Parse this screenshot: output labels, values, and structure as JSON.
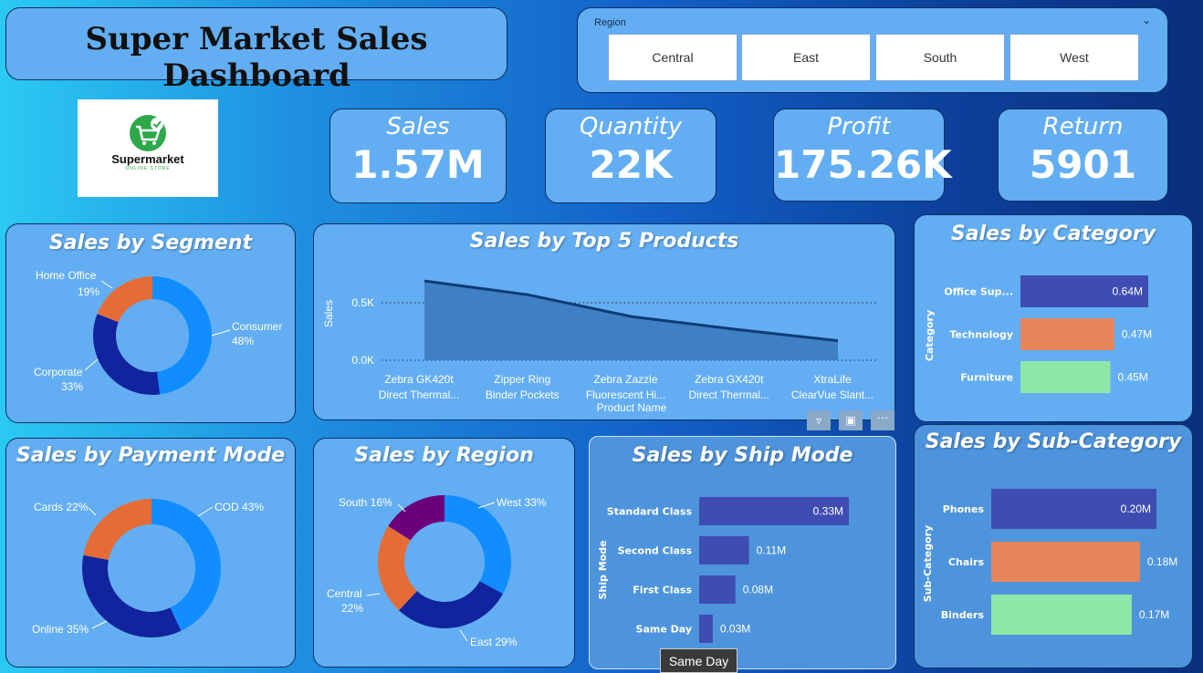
{
  "dashboard": {
    "title": "Super Market Sales Dashboard"
  },
  "slicer": {
    "label": "Region",
    "options": [
      "Central",
      "East",
      "South",
      "West"
    ]
  },
  "logo": {
    "name": "Supermarket",
    "tagline": "ONLINE STORE"
  },
  "kpis": [
    {
      "label": "Sales",
      "value": "1.57M"
    },
    {
      "label": "Quantity",
      "value": "22K"
    },
    {
      "label": "Profit",
      "value": "175.26K"
    },
    {
      "label": "Return",
      "value": "5901"
    }
  ],
  "tooltip": {
    "text": "Same Day"
  },
  "colors": {
    "blue": "#118dff",
    "navy": "#12239e",
    "orange": "#e66c37",
    "purple": "#6b007b",
    "barBlue": "#3f4db3",
    "barOrange": "#e8845a",
    "barGreen": "#8de8a8"
  },
  "chart_data": [
    {
      "id": "segment",
      "type": "pie",
      "title": "Sales by Segment",
      "categories": [
        "Consumer",
        "Corporate",
        "Home Office"
      ],
      "values": [
        48,
        33,
        19
      ],
      "labels": [
        [
          "Consumer",
          "48%"
        ],
        [
          "Corporate",
          "33%"
        ],
        [
          "Home Office",
          "19%"
        ]
      ]
    },
    {
      "id": "top5",
      "type": "area",
      "title": "Sales by Top 5 Products",
      "xlabel": "Product Name",
      "ylabel": "Sales",
      "categories": [
        [
          "Zebra GK420t",
          "Direct Thermal..."
        ],
        [
          "Zipper Ring",
          "Binder Pockets"
        ],
        [
          "Zebra Zazzle",
          "Fluorescent Hi..."
        ],
        [
          "Zebra GX420t",
          "Direct Thermal..."
        ],
        [
          "XtraLife",
          "ClearVue Slant..."
        ]
      ],
      "values": [
        0.69,
        0.57,
        0.38,
        0.27,
        0.17
      ],
      "yticks": [
        "0.0K",
        "0.5K"
      ],
      "ylim": [
        0,
        0.75
      ]
    },
    {
      "id": "category",
      "type": "bar",
      "title": "Sales by Category",
      "ylabel": "Category",
      "categories": [
        "Office Sup...",
        "Technology",
        "Furniture"
      ],
      "values": [
        0.64,
        0.47,
        0.45
      ],
      "value_labels": [
        "0.64M",
        "0.47M",
        "0.45M"
      ]
    },
    {
      "id": "payment",
      "type": "pie",
      "title": "Sales by Payment Mode",
      "categories": [
        "COD",
        "Online",
        "Cards"
      ],
      "values": [
        43,
        35,
        22
      ],
      "labels": [
        "COD 43%",
        "Online 35%",
        "Cards 22%"
      ]
    },
    {
      "id": "region",
      "type": "pie",
      "title": "Sales by Region",
      "categories": [
        "West",
        "East",
        "Central",
        "South"
      ],
      "values": [
        33,
        29,
        22,
        16
      ],
      "labels": [
        [
          "West 33%"
        ],
        [
          "East 29%"
        ],
        [
          "Central",
          "22%"
        ],
        [
          "South 16%"
        ]
      ]
    },
    {
      "id": "shipmode",
      "type": "bar",
      "title": "Sales by Ship Mode",
      "ylabel": "Ship Mode",
      "categories": [
        "Standard Class",
        "Second Class",
        "First Class",
        "Same Day"
      ],
      "values": [
        0.33,
        0.11,
        0.08,
        0.03
      ],
      "value_labels": [
        "0.33M",
        "0.11M",
        "0.08M",
        "0.03M"
      ]
    },
    {
      "id": "subcategory",
      "type": "bar",
      "title": "Sales by Sub-Category",
      "ylabel": "Sub-Category",
      "categories": [
        "Phones",
        "Chairs",
        "Binders"
      ],
      "values": [
        0.2,
        0.18,
        0.17
      ],
      "value_labels": [
        "0.20M",
        "0.18M",
        "0.17M"
      ]
    }
  ]
}
